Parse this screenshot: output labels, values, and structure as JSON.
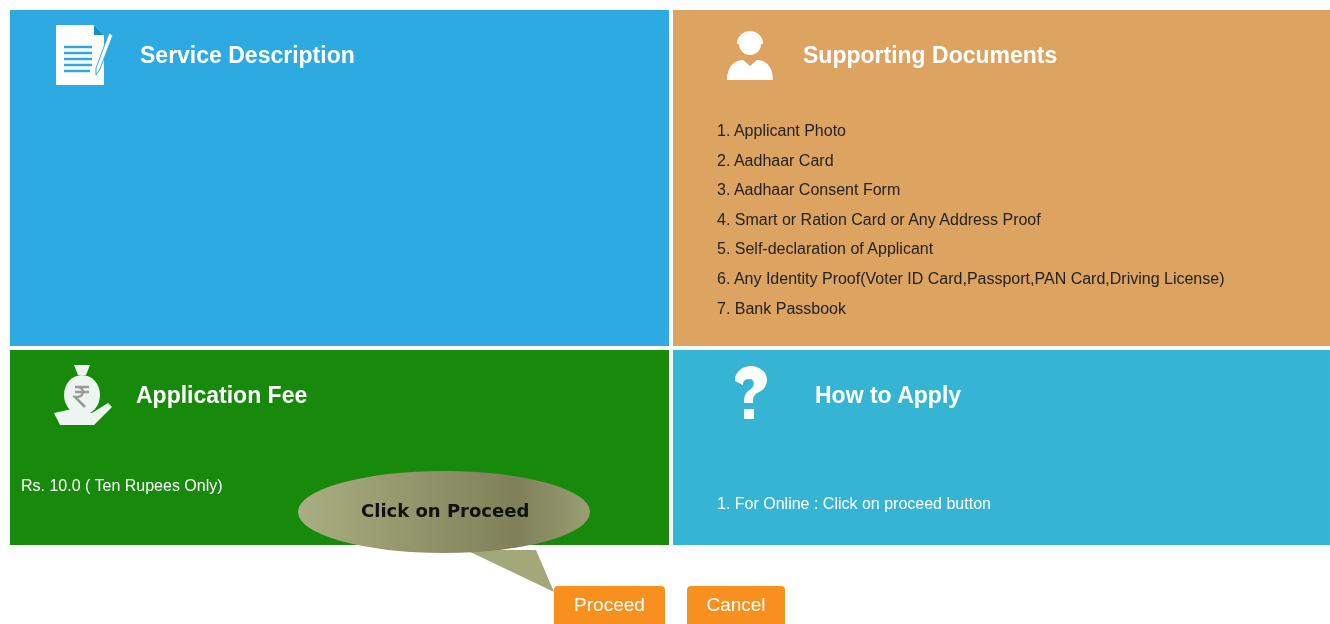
{
  "panels": [
    {
      "kind": "document",
      "title": "Service Description"
    },
    {
      "kind": "support",
      "title": "Supporting Documents",
      "items": [
        "1. Applicant Photo",
        "2. Aadhaar Card",
        "3. Aadhaar Consent Form",
        "4. Smart or Ration Card or Any Address Proof",
        "5. Self-declaration of Applicant",
        "6. Any Identity Proof(Voter ID Card,Passport,PAN Card,Driving License)",
        "7. Bank Passbook"
      ]
    },
    {
      "kind": "fee",
      "title": "Application Fee",
      "items": [
        "Rs. 10.0 ( Ten Rupees Only)"
      ]
    },
    {
      "kind": "help",
      "title": "How to Apply",
      "items": [
        "1. For Online : Click on proceed button"
      ]
    }
  ],
  "buttons": [
    {
      "kind": "proceed",
      "label": "Proceed"
    },
    {
      "kind": "cancel",
      "label": "Cancel"
    }
  ],
  "callout": {
    "text": "Click on Proceed"
  }
}
